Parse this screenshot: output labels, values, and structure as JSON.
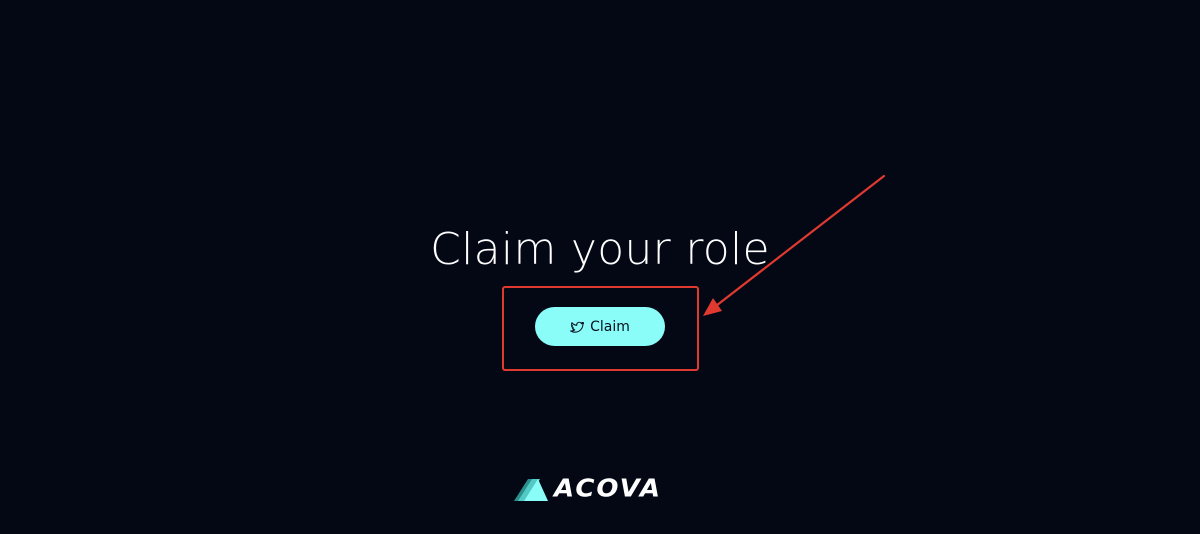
{
  "main": {
    "title": "Claim your role",
    "claim_button": {
      "label": "Claim",
      "icon": "twitter-bird-icon"
    }
  },
  "footer": {
    "logo_text": "ACOVA",
    "logo_icon": "triangle-logo-icon"
  },
  "annotation": {
    "highlight_color": "#e0392f"
  },
  "colors": {
    "background": "#040815",
    "accent": "#8bfdf9",
    "text": "#ffffff"
  }
}
